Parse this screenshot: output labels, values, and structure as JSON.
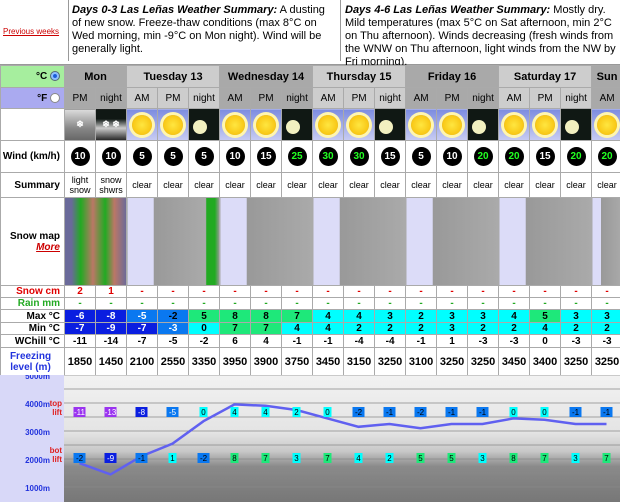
{
  "nav": {
    "previous_weeks": "Previous weeks"
  },
  "summary_days_0_3": {
    "title": "Days 0-3 Las Leñas Weather Summary:",
    "text": " A dusting of new snow. Freeze-thaw conditions (max 8°C on Wed morning, min -9°C on Mon night). Wind will be generally light."
  },
  "summary_days_4_6": {
    "title": "Days 4-6 Las Leñas Weather Summary:",
    "text": " Mostly dry. Mild temperatures (max 5°C on Sat afternoon, min 2°C on Thu afternoon). Winds decreasing (fresh winds from the WNW on Thu afternoon, light winds from the NW by Fri morning)."
  },
  "units": {
    "celsius": "°C",
    "fahrenheit": "°F",
    "selected": "celsius"
  },
  "labels": {
    "wind": "Wind (km/h)",
    "summary": "Summary",
    "snow_map": "Snow map",
    "more": "More",
    "snow": "Snow cm",
    "rain": "Rain mm",
    "max": "Max °C",
    "min": "Min °C",
    "wchill": "WChill °C",
    "freezing": "Freezing level (m)",
    "top_lift": "top lift",
    "bot_lift": "bot lift",
    "alts": [
      "5000m",
      "4000m",
      "3000m",
      "2000m",
      "1000m"
    ]
  },
  "days": [
    {
      "label": "Mon",
      "span": 2
    },
    {
      "label": "Tuesday 13",
      "span": 3
    },
    {
      "label": "Wednesday 14",
      "span": 3
    },
    {
      "label": "Thursday 15",
      "span": 3
    },
    {
      "label": "Friday 16",
      "span": 3
    },
    {
      "label": "Saturday 17",
      "span": 3
    },
    {
      "label": "Sun",
      "span": 1
    }
  ],
  "periods": [
    "PM",
    "night",
    "AM",
    "PM",
    "night",
    "AM",
    "PM",
    "night",
    "AM",
    "PM",
    "night",
    "AM",
    "PM",
    "night",
    "AM",
    "PM",
    "night",
    "AM"
  ],
  "icons": [
    "cloud-snow",
    "moon-cloud-snow",
    "sun",
    "sun",
    "moon",
    "sun",
    "sun",
    "moon",
    "sun",
    "sun",
    "moon",
    "sun",
    "sun",
    "moon",
    "sun",
    "sun",
    "moon",
    "sun"
  ],
  "wind": [
    "10",
    "10",
    "5",
    "5",
    "5",
    "10",
    "15",
    "25",
    "30",
    "30",
    "15",
    "5",
    "10",
    "20",
    "20",
    "15",
    "20",
    "20"
  ],
  "weather": [
    "light snow",
    "snow shwrs",
    "clear",
    "clear",
    "clear",
    "clear",
    "clear",
    "clear",
    "clear",
    "clear",
    "clear",
    "clear",
    "clear",
    "clear",
    "clear",
    "clear",
    "clear",
    "clear"
  ],
  "snow": [
    "2",
    "1",
    "-",
    "-",
    "-",
    "-",
    "-",
    "-",
    "-",
    "-",
    "-",
    "-",
    "-",
    "-",
    "-",
    "-",
    "-",
    "-"
  ],
  "rain": [
    "-",
    "-",
    "-",
    "-",
    "-",
    "-",
    "-",
    "-",
    "-",
    "-",
    "-",
    "-",
    "-",
    "-",
    "-",
    "-",
    "-",
    "-"
  ],
  "max": [
    "-6",
    "-8",
    "-5",
    "-2",
    "5",
    "8",
    "8",
    "7",
    "4",
    "4",
    "3",
    "2",
    "3",
    "3",
    "4",
    "5",
    "3",
    "3"
  ],
  "min": [
    "-7",
    "-9",
    "-7",
    "-3",
    "0",
    "7",
    "7",
    "4",
    "4",
    "2",
    "2",
    "2",
    "3",
    "2",
    "2",
    "4",
    "2",
    "2"
  ],
  "wchill": [
    "-11",
    "-14",
    "-7",
    "-5",
    "-2",
    "6",
    "4",
    "-1",
    "-1",
    "-4",
    "-4",
    "-1",
    "1",
    "-3",
    "-3",
    "0",
    "-3",
    "-3"
  ],
  "freezing": [
    "1850",
    "1450",
    "2100",
    "2550",
    "3350",
    "3950",
    "3900",
    "3750",
    "3450",
    "3150",
    "3250",
    "3100",
    "3250",
    "3250",
    "3450",
    "3400",
    "3250",
    "3250"
  ],
  "top_lift": [
    "-11",
    "-13",
    "-8",
    "-5",
    "0",
    "4",
    "4",
    "2",
    "0",
    "-2",
    "-1",
    "-2",
    "-1",
    "-1",
    "0",
    "0",
    "-1",
    "-1"
  ],
  "bot_lift": [
    "-2",
    "-9",
    "-1",
    "1",
    "-2",
    "8",
    "7",
    "3",
    "7",
    "4",
    "2",
    "5",
    "5",
    "3",
    "8",
    "7",
    "3",
    "7"
  ],
  "colors": {
    "very_cold": "#9a33f0",
    "cold": "#0a1ee0",
    "cool": "#0a78f0",
    "mild": "#00ffff",
    "warm": "#1ee87a",
    "freezing_line": "#6060f0",
    "snow_red": "#e00000",
    "rain_green": "#22aa22"
  }
}
